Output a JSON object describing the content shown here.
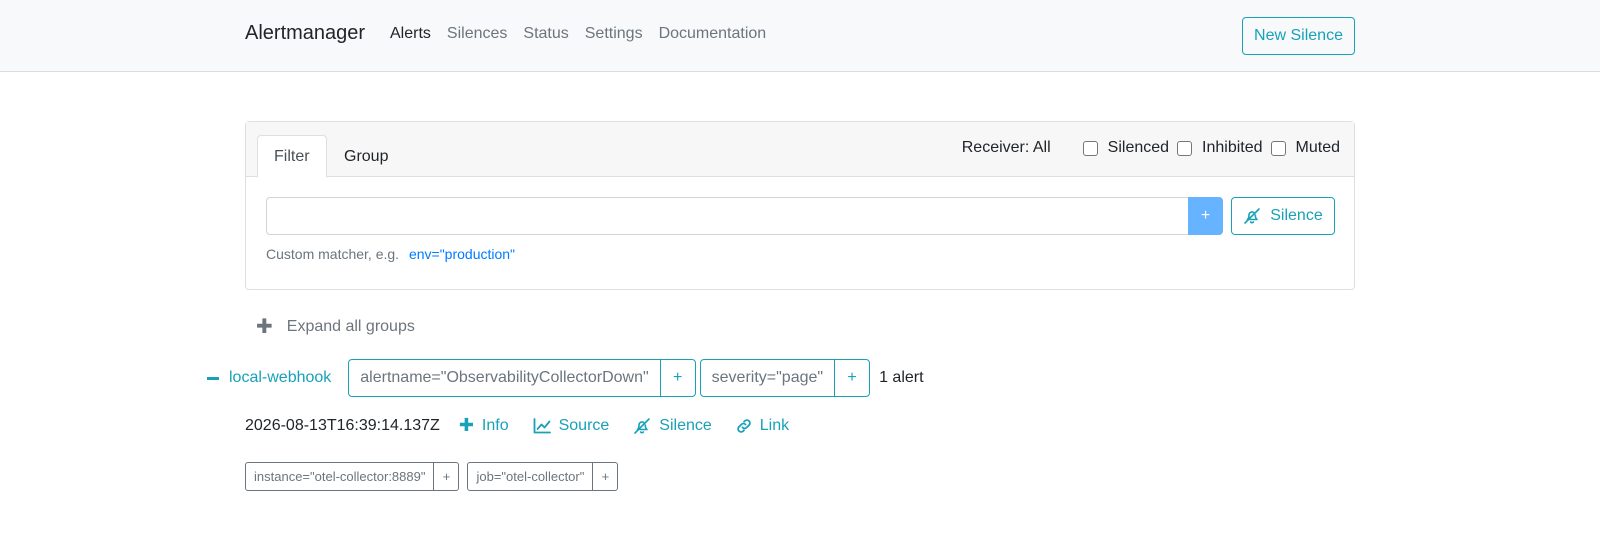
{
  "navbar": {
    "brand": "Alertmanager",
    "links": [
      "Alerts",
      "Silences",
      "Status",
      "Settings",
      "Documentation"
    ],
    "active_link": "Alerts",
    "new_silence_label": "New Silence"
  },
  "filter_card": {
    "tabs": [
      "Filter",
      "Group"
    ],
    "active_tab": "Filter",
    "receiver_label": "Receiver: All",
    "checkboxes": [
      {
        "label": "Silenced",
        "checked": false
      },
      {
        "label": "Inhibited",
        "checked": false
      },
      {
        "label": "Muted",
        "checked": false
      }
    ],
    "input_value": "",
    "add_button": "+",
    "silence_button": "Silence",
    "hint_prefix": "Custom matcher, e.g.",
    "hint_example": "env=\"production\""
  },
  "expand_all_label": "Expand all groups",
  "group": {
    "receiver": "local-webhook",
    "matchers": [
      {
        "text": "alertname=\"ObservabilityCollectorDown\"",
        "add": "+"
      },
      {
        "text": "severity=\"page\"",
        "add": "+"
      }
    ],
    "alert_count": "1 alert"
  },
  "alert": {
    "timestamp": "2026-08-13T16:39:14.137Z",
    "actions": [
      "Info",
      "Source",
      "Silence",
      "Link"
    ],
    "labels": [
      {
        "text": "instance=\"otel-collector:8889\"",
        "add": "+"
      },
      {
        "text": "job=\"otel-collector\"",
        "add": "+"
      }
    ]
  },
  "colors": {
    "accent": "#17a2b8",
    "primary_light": "#66b3ff",
    "link": "#007bff",
    "muted": "#6c757d"
  }
}
